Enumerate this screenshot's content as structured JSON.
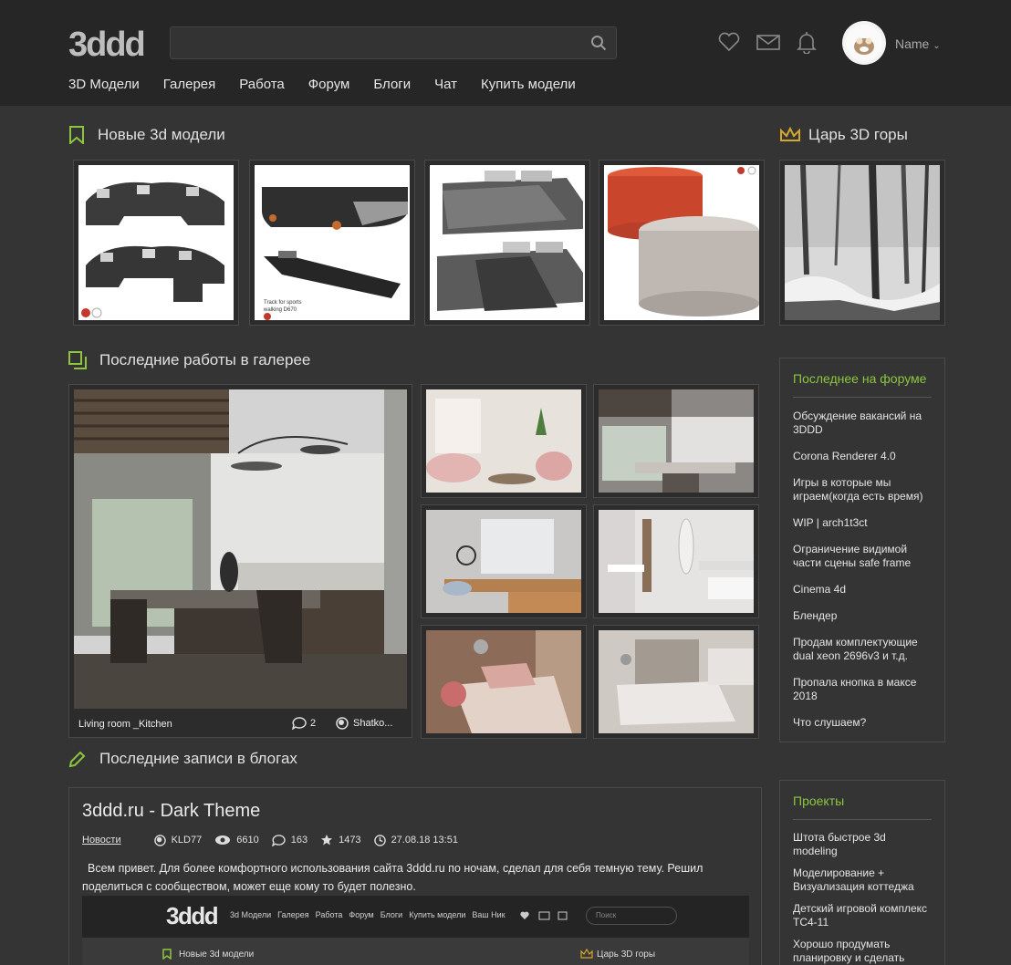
{
  "header": {
    "logo_text": "3ddd",
    "search_placeholder": "",
    "username": "Name",
    "nav": [
      "3D Модели",
      "Галерея",
      "Работа",
      "Форум",
      "Блоги",
      "Чат",
      "Купить модели"
    ]
  },
  "sections": {
    "new_models": "Новые 3d модели",
    "king": "Царь 3D горы",
    "gallery": "Последние работы в галерее",
    "blogs": "Последние записи в блогах"
  },
  "gallery_main": {
    "caption": "Living room _Kitchen",
    "comments": "2",
    "author": "Shatko..."
  },
  "model_tiles": [
    {
      "note": ""
    },
    {
      "note": "Track for sports\nwalking D670"
    },
    {
      "note": ""
    },
    {
      "note": ""
    }
  ],
  "forum": {
    "title": "Последнее на форуме",
    "items": [
      "Обсуждение вакансий на 3DDD",
      "Corona Renderer 4.0",
      "Игры в которые мы играем(когда есть время)",
      "WIP | arch1t3ct",
      "Ограничение видимой части сцены safe frame",
      "Cinema 4d",
      "Блендер",
      "Продам комплектующие dual xeon 2696v3 и т.д.",
      "Пропала кнопка в максе 2018",
      "Что слушаем?"
    ]
  },
  "projects": {
    "title": "Проекты",
    "items": [
      "Штота быстрое 3d modeling",
      "Моделирование + Визуализация коттеджа",
      "Детский игровой комплекс ТС4-11",
      "Хорошо продумать планировку и сделать рабочку к квартире"
    ]
  },
  "blog_post": {
    "title": "3ddd.ru - Dark Theme",
    "category": "Новости",
    "author": "KLD77",
    "views": "6610",
    "comments": "163",
    "rating": "1473",
    "date": "27.08.18 13:51",
    "text": "Всем привет. Для более комфортного использования сайта 3ddd.ru по ночам, сделал для себя темную тему. Решил поделиться с сообществом, может еще кому то будет полезно."
  },
  "blog_screenshot": {
    "logo": "3ddd",
    "nav": [
      "3d Модели",
      "Галерея",
      "Работа",
      "Форум",
      "Блоги",
      "Купить модели",
      "Ваш Ник"
    ],
    "search_placeholder": "Поиск",
    "left_heading": "Новые 3d модели",
    "right_heading": "Царь 3D горы"
  },
  "colors": {
    "accent_green": "#8cc63f",
    "crown_gold": "#d4a72c",
    "background": "#343434",
    "header": "#262626"
  }
}
